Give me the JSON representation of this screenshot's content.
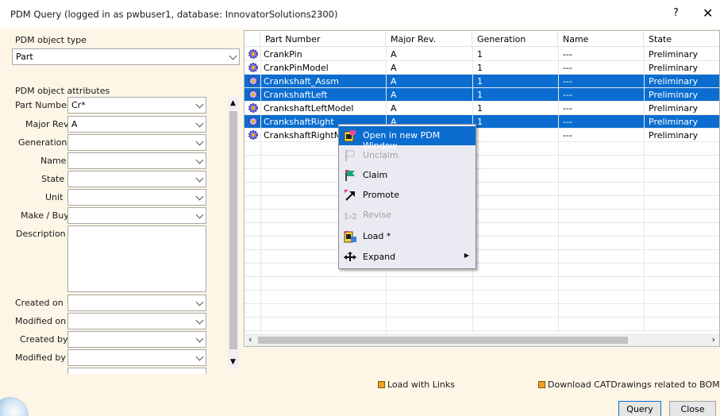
{
  "window": {
    "title": "PDM Query (logged in as pwbuser1, database: InnovatorSolutions2300)",
    "help": "?",
    "close": "✕"
  },
  "left": {
    "object_type_label": "PDM object type",
    "object_type_value": "Part",
    "attributes_label": "PDM object attributes",
    "fields": {
      "part_number": {
        "label": "Part Number",
        "value": "Cr*"
      },
      "major_rev": {
        "label": "Major Rev.",
        "value": "A"
      },
      "generation": {
        "label": "Generation",
        "value": ""
      },
      "name": {
        "label": "Name",
        "value": ""
      },
      "state": {
        "label": "State",
        "value": ""
      },
      "unit": {
        "label": "Unit",
        "value": ""
      },
      "make_buy": {
        "label": "Make / Buy",
        "value": ""
      },
      "description": {
        "label": "Description",
        "value": ""
      },
      "created_on": {
        "label": "Created on",
        "value": ""
      },
      "modified_on": {
        "label": "Modified on",
        "value": ""
      },
      "created_by": {
        "label": "Created by",
        "value": ""
      },
      "modified_by": {
        "label": "Modified by",
        "value": ""
      }
    }
  },
  "grid": {
    "columns": [
      "Part Number",
      "Major Rev.",
      "Generation",
      "Name",
      "State"
    ],
    "rows": [
      {
        "part": "CrankPin",
        "rev": "A",
        "gen": "1",
        "name": "---",
        "state": "Preliminary",
        "selected": false
      },
      {
        "part": "CrankPinModel",
        "rev": "A",
        "gen": "1",
        "name": "---",
        "state": "Preliminary",
        "selected": false
      },
      {
        "part": "Crankshaft_Assm",
        "rev": "A",
        "gen": "1",
        "name": "---",
        "state": "Preliminary",
        "selected": true
      },
      {
        "part": "CrankshaftLeft",
        "rev": "A",
        "gen": "1",
        "name": "---",
        "state": "Preliminary",
        "selected": true
      },
      {
        "part": "CrankshaftLeftModel",
        "rev": "A",
        "gen": "1",
        "name": "---",
        "state": "Preliminary",
        "selected": false
      },
      {
        "part": "CrankshaftRight",
        "rev": "A",
        "gen": "1",
        "name": "---",
        "state": "Preliminary",
        "selected": true
      },
      {
        "part": "CrankshaftRightMod",
        "rev": "",
        "gen": "",
        "name": "---",
        "state": "Preliminary",
        "selected": false
      }
    ]
  },
  "context_menu": {
    "items": [
      {
        "label": "Open in new PDM Window",
        "enabled": true,
        "highlighted": true,
        "icon": "open-window-icon"
      },
      {
        "label": "Unclaim",
        "enabled": false,
        "icon": "unclaim-flag-icon"
      },
      {
        "label": "Claim",
        "enabled": true,
        "icon": "claim-flag-icon"
      },
      {
        "label": "Promote",
        "enabled": true,
        "icon": "promote-arrow-icon"
      },
      {
        "label": "Revise",
        "enabled": false,
        "icon": "revise-icon"
      },
      {
        "label": "Load *",
        "enabled": true,
        "icon": "load-icon"
      },
      {
        "label": "Expand",
        "enabled": true,
        "icon": "expand-arrows-icon",
        "submenu": true
      }
    ]
  },
  "options": {
    "load_with_links": "Load with Links",
    "download_catdrawings": "Download CATDrawings related to BOM Part"
  },
  "buttons": {
    "query": "Query",
    "close": "Close"
  },
  "colors": {
    "selection": "#0a6dcf",
    "dialog_background": "#fdf6e6",
    "checkbox": "#f0a01c"
  }
}
